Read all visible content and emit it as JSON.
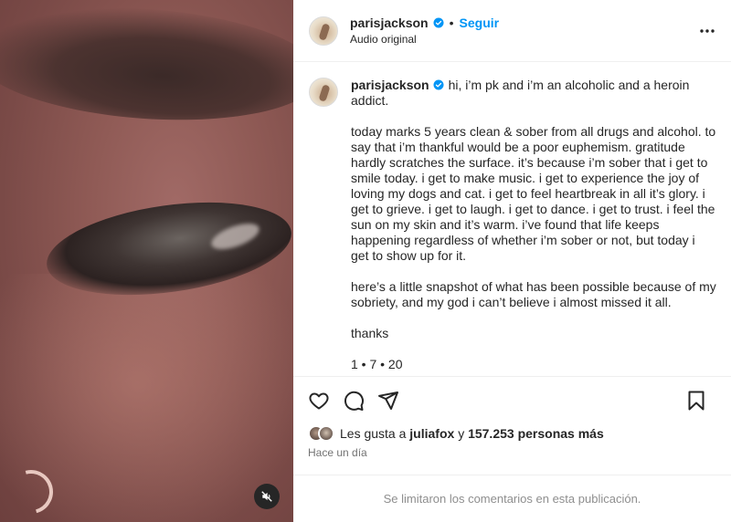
{
  "post": {
    "username": "parisjackson",
    "follow_label": "Seguir",
    "separator": "•",
    "audio_label": "Audio original",
    "more_icon": "more-horizontal-icon"
  },
  "caption": {
    "username": "parisjackson",
    "first_line": "hi, i’m pk and i’m an alcoholic and a heroin addict.",
    "paragraph1": "today marks 5 years clean & sober from all drugs and alcohol. to say that i’m thankful would be a poor euphemism. gratitude hardly scratches the surface. it’s because i’m sober that i get to smile today. i get to make music. i get to experience the joy of loving my dogs and cat. i get to feel heartbreak in all it’s glory. i get to grieve. i get to laugh. i get to dance. i get to trust. i feel the sun on my skin and it’s warm. i’ve found that life keeps happening regardless of whether i’m sober or not, but today i get to show up for it.",
    "paragraph2": "here’s a little snapshot of what has been possible because of my sobriety, and my god i can’t believe i almost missed it all.",
    "paragraph3": "thanks",
    "date_line": "1 • 7 • 20"
  },
  "actions": {
    "like_icon": "heart-icon",
    "comment_icon": "comment-icon",
    "share_icon": "share-icon",
    "save_icon": "bookmark-icon"
  },
  "likes": {
    "prefix": "Les gusta a",
    "user": "juliafox",
    "middle": "y",
    "count": "157.253 personas más"
  },
  "timestamp": "Hace un día",
  "comments_disabled": "Se limitaron los comentarios en esta publicación.",
  "colors": {
    "accent": "#0095f6",
    "text": "#262626",
    "muted": "#737373"
  }
}
